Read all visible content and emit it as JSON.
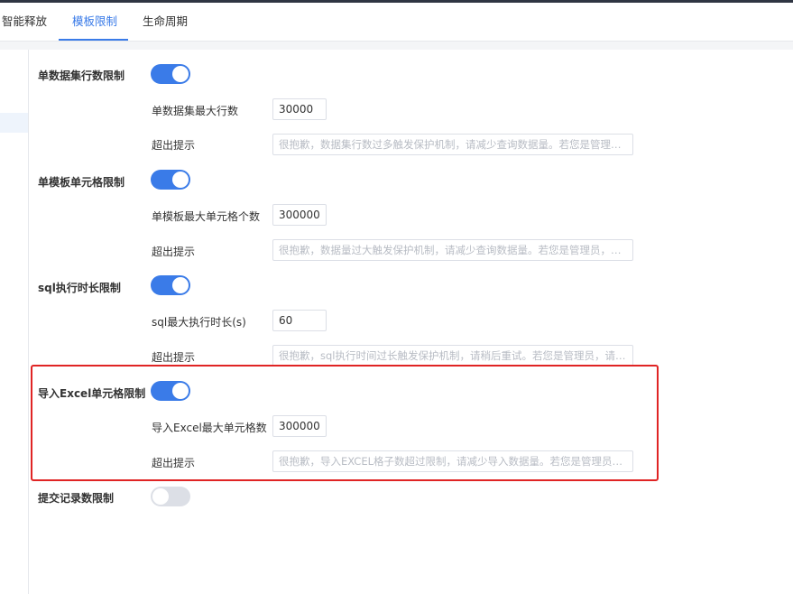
{
  "tabs": [
    {
      "label": "智能释放"
    },
    {
      "label": "模板限制"
    },
    {
      "label": "生命周期"
    }
  ],
  "settings": {
    "dataset_rows": {
      "label": "单数据集行数限制",
      "enabled": true,
      "max_label": "单数据集最大行数",
      "max_value": "30000",
      "tip_label": "超出提示",
      "tip_placeholder": "很抱歉，数据集行数过多触发保护机制，请减少查询数据量。若您是管理员，请前往运维管理调整限制。"
    },
    "template_cells": {
      "label": "单模板单元格限制",
      "enabled": true,
      "max_label": "单模板最大单元格个数",
      "max_value": "300000",
      "tip_label": "超出提示",
      "tip_placeholder": "很抱歉，数据量过大触发保护机制，请减少查询数据量。若您是管理员，请前往运维管理调整限制。"
    },
    "sql_duration": {
      "label": "sql执行时长限制",
      "enabled": true,
      "max_label": "sql最大执行时长(s)",
      "max_value": "60",
      "tip_label": "超出提示",
      "tip_placeholder": "很抱歉，sql执行时间过长触发保护机制，请稍后重试。若您是管理员，请前往运维管理调整限制。"
    },
    "excel_import": {
      "label": "导入Excel单元格限制",
      "enabled": true,
      "max_label": "导入Excel最大单元格数",
      "max_value": "300000",
      "tip_label": "超出提示",
      "tip_placeholder": "很抱歉，导入EXCEL格子数超过限制，请减少导入数据量。若您是管理员，请前往运维管理调整限制。"
    },
    "submit_records": {
      "label": "提交记录数限制",
      "enabled": false
    }
  },
  "colors": {
    "accent": "#3a7be8",
    "highlight": "#e02424",
    "toggle_off": "#dcdfe6"
  }
}
